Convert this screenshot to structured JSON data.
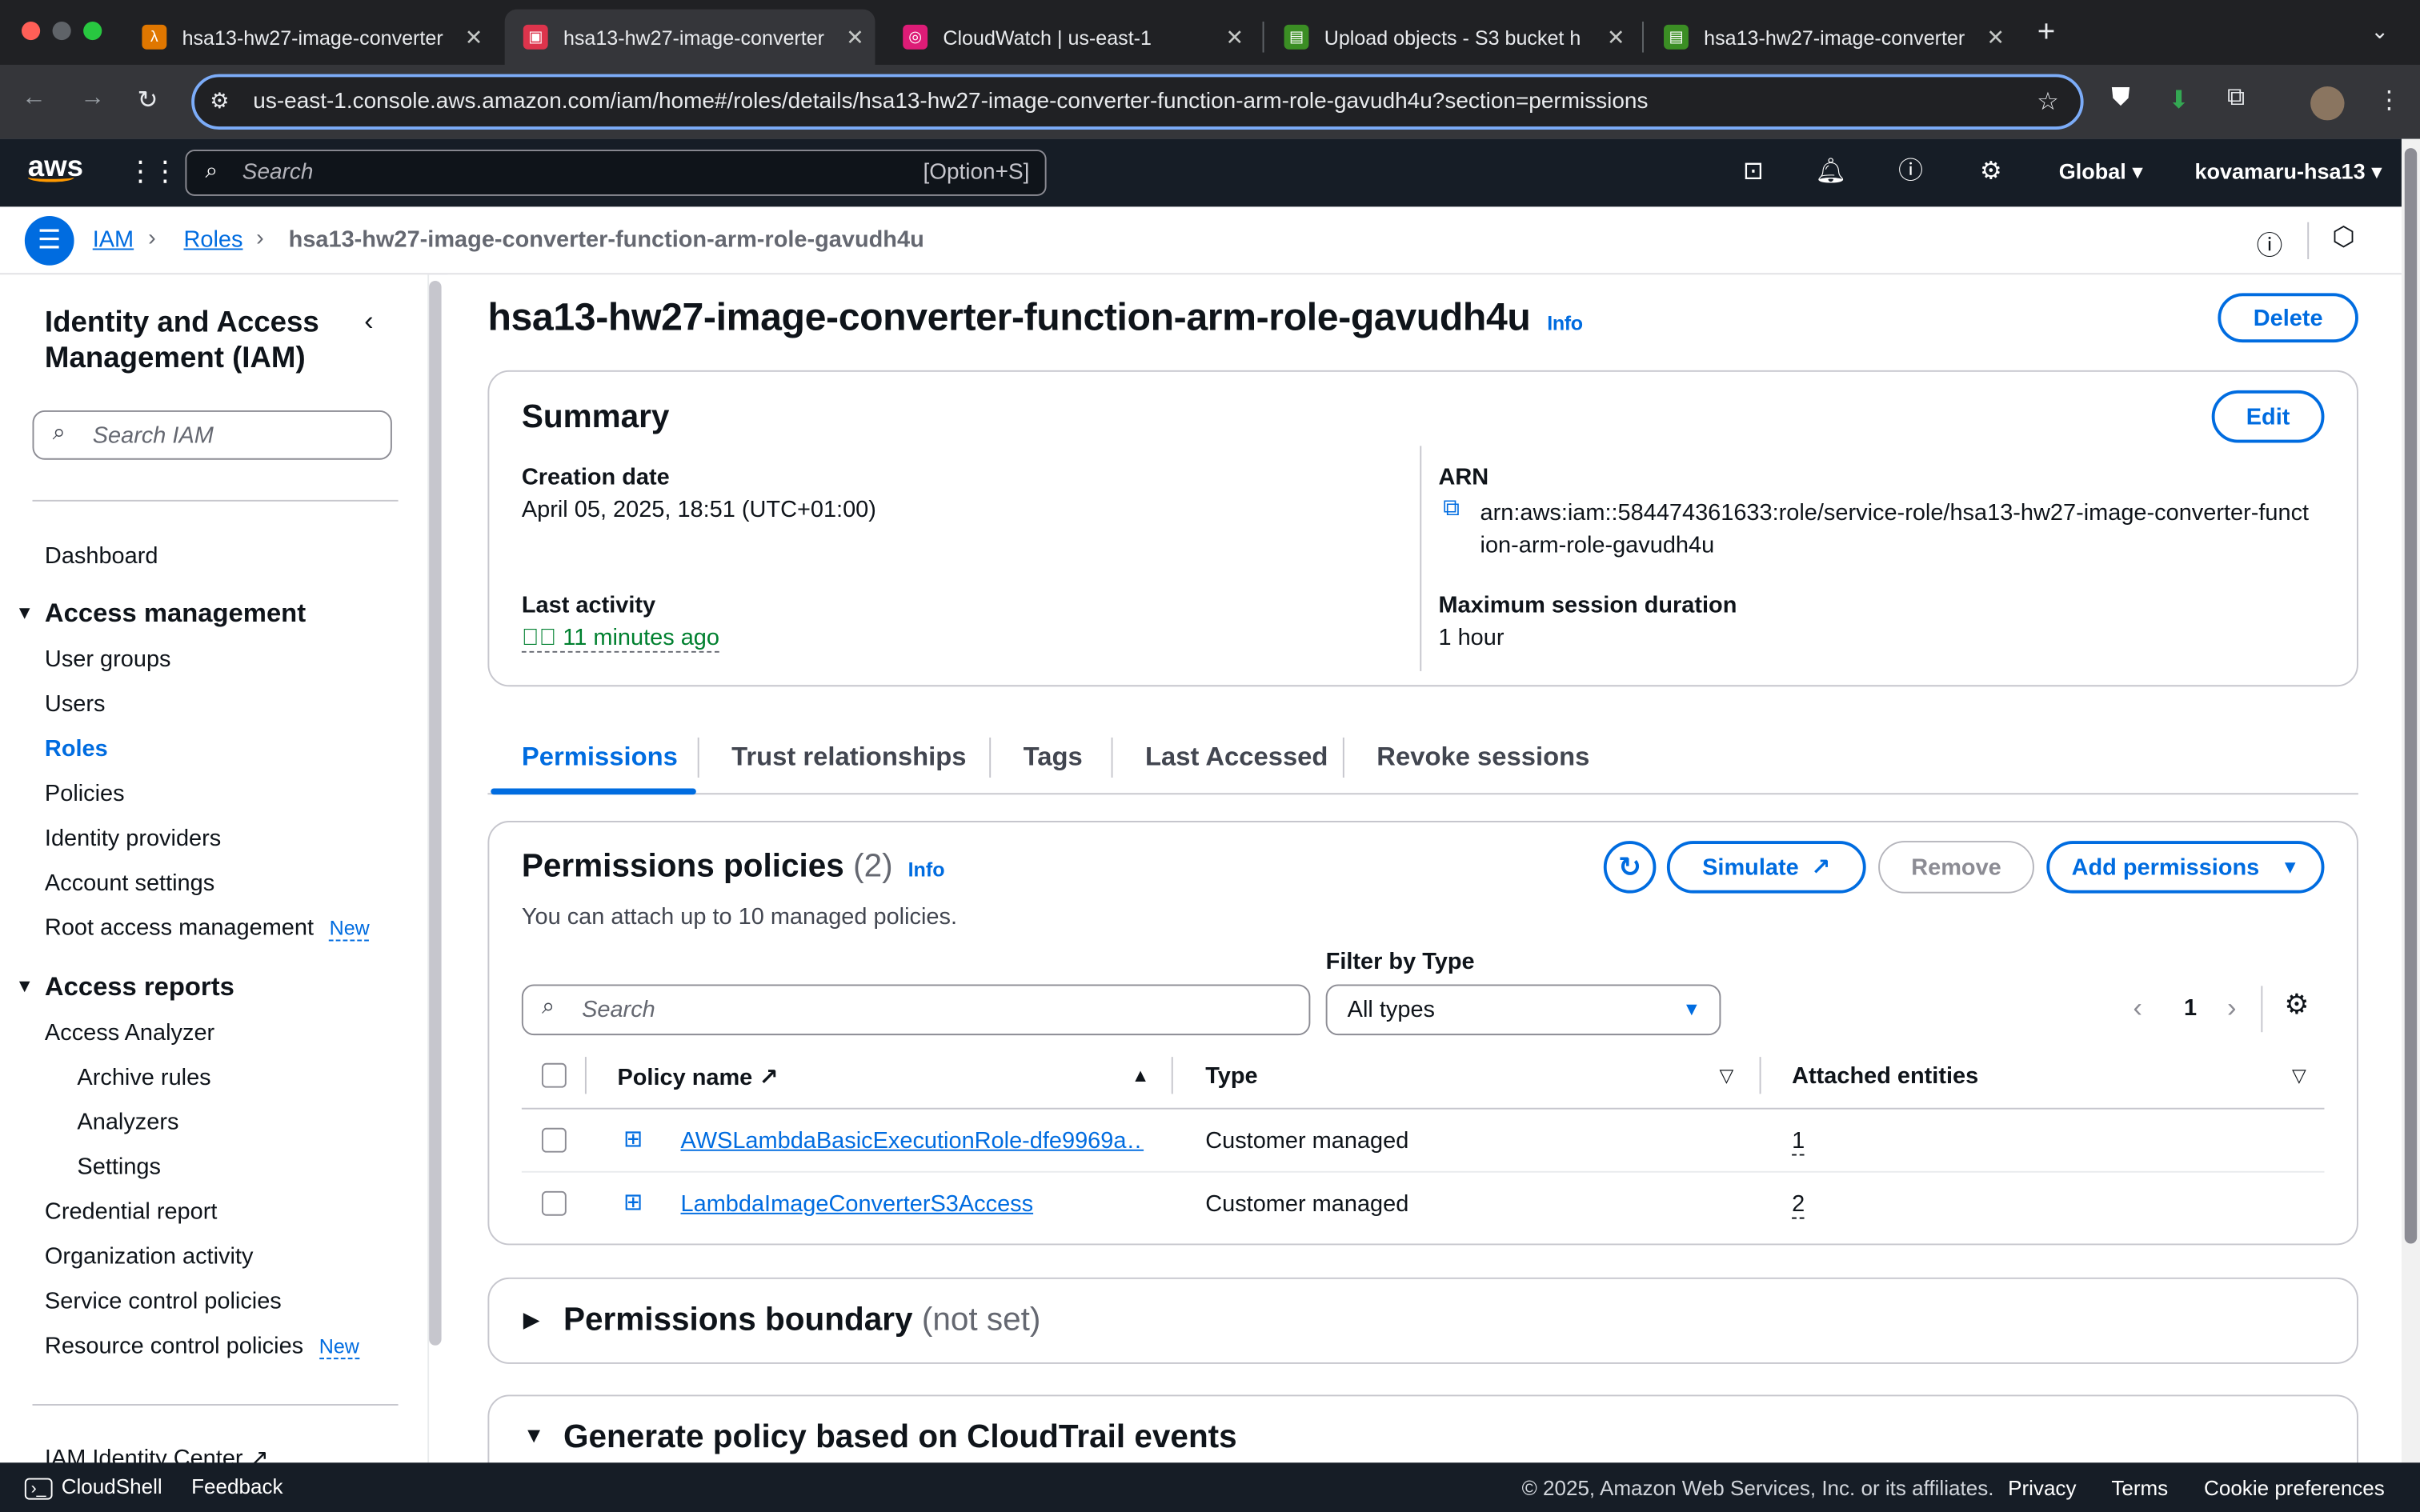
{
  "browser": {
    "tabs": [
      {
        "title": "hsa13-hw27-image-converter",
        "favicon_color": "#e07700"
      },
      {
        "title": "hsa13-hw27-image-converter",
        "favicon_color": "#dd344c"
      },
      {
        "title": "CloudWatch | us-east-1",
        "favicon_color": "#dd1c77"
      },
      {
        "title": "Upload objects - S3 bucket h",
        "favicon_color": "#3b8e24"
      },
      {
        "title": "hsa13-hw27-image-converter",
        "favicon_color": "#3b8e24"
      }
    ],
    "url": "us-east-1.console.aws.amazon.com/iam/home#/roles/details/hsa13-hw27-image-converter-function-arm-role-gavudh4u?section=permissions"
  },
  "aws_header": {
    "logo": "aws",
    "search_placeholder": "Search",
    "search_shortcut": "[Option+S]",
    "region": "Global",
    "account": "kovamaru-hsa13"
  },
  "breadcrumb": [
    "IAM",
    "Roles",
    "hsa13-hw27-image-converter-function-arm-role-gavudh4u"
  ],
  "sidebar": {
    "title": "Identity and Access Management (IAM)",
    "search_placeholder": "Search IAM",
    "dashboard": "Dashboard",
    "access_management": "Access management",
    "am_items": [
      "User groups",
      "Users",
      "Roles",
      "Policies",
      "Identity providers",
      "Account settings",
      "Root access management"
    ],
    "new_badge": "New",
    "access_reports": "Access reports",
    "ar_items": [
      "Access Analyzer",
      "Archive rules",
      "Analyzers",
      "Settings",
      "Credential report",
      "Organization activity",
      "Service control policies",
      "Resource control policies"
    ],
    "identity_center": "IAM Identity Center"
  },
  "page": {
    "title": "hsa13-hw27-image-converter-function-arm-role-gavudh4u",
    "info": "Info",
    "delete": "Delete"
  },
  "summary": {
    "heading": "Summary",
    "edit": "Edit",
    "creation_label": "Creation date",
    "creation_value": "April 05, 2025, 18:51 (UTC+01:00)",
    "arn_label": "ARN",
    "arn_value": "arn:aws:iam::584474361633:role/service-role/hsa13-hw27-image-converter-function-arm-role-gavudh4u",
    "last_activity_label": "Last activity",
    "last_activity_value": "11 minutes ago",
    "max_session_label": "Maximum session duration",
    "max_session_value": "1 hour"
  },
  "tabs": [
    "Permissions",
    "Trust relationships",
    "Tags",
    "Last Accessed",
    "Revoke sessions"
  ],
  "policies": {
    "heading": "Permissions policies",
    "count": "(2)",
    "info": "Info",
    "subtitle": "You can attach up to 10 managed policies.",
    "simulate": "Simulate",
    "remove": "Remove",
    "add": "Add permissions",
    "filter_label": "Filter by Type",
    "search_placeholder": "Search",
    "filter_value": "All types",
    "page": "1",
    "columns": [
      "Policy name",
      "Type",
      "Attached entities"
    ],
    "rows": [
      {
        "name": "AWSLambdaBasicExecutionRole-dfe9969a…",
        "type": "Customer managed",
        "entities": "1"
      },
      {
        "name": "LambdaImageConverterS3Access",
        "type": "Customer managed",
        "entities": "2"
      }
    ]
  },
  "boundary": {
    "heading": "Permissions boundary",
    "status": "(not set)"
  },
  "cloudtrail": {
    "heading": "Generate policy based on CloudTrail events"
  },
  "footer": {
    "cloudshell": "CloudShell",
    "feedback": "Feedback",
    "copyright": "© 2025, Amazon Web Services, Inc. or its affiliates.",
    "privacy": "Privacy",
    "terms": "Terms",
    "cookies": "Cookie preferences"
  }
}
